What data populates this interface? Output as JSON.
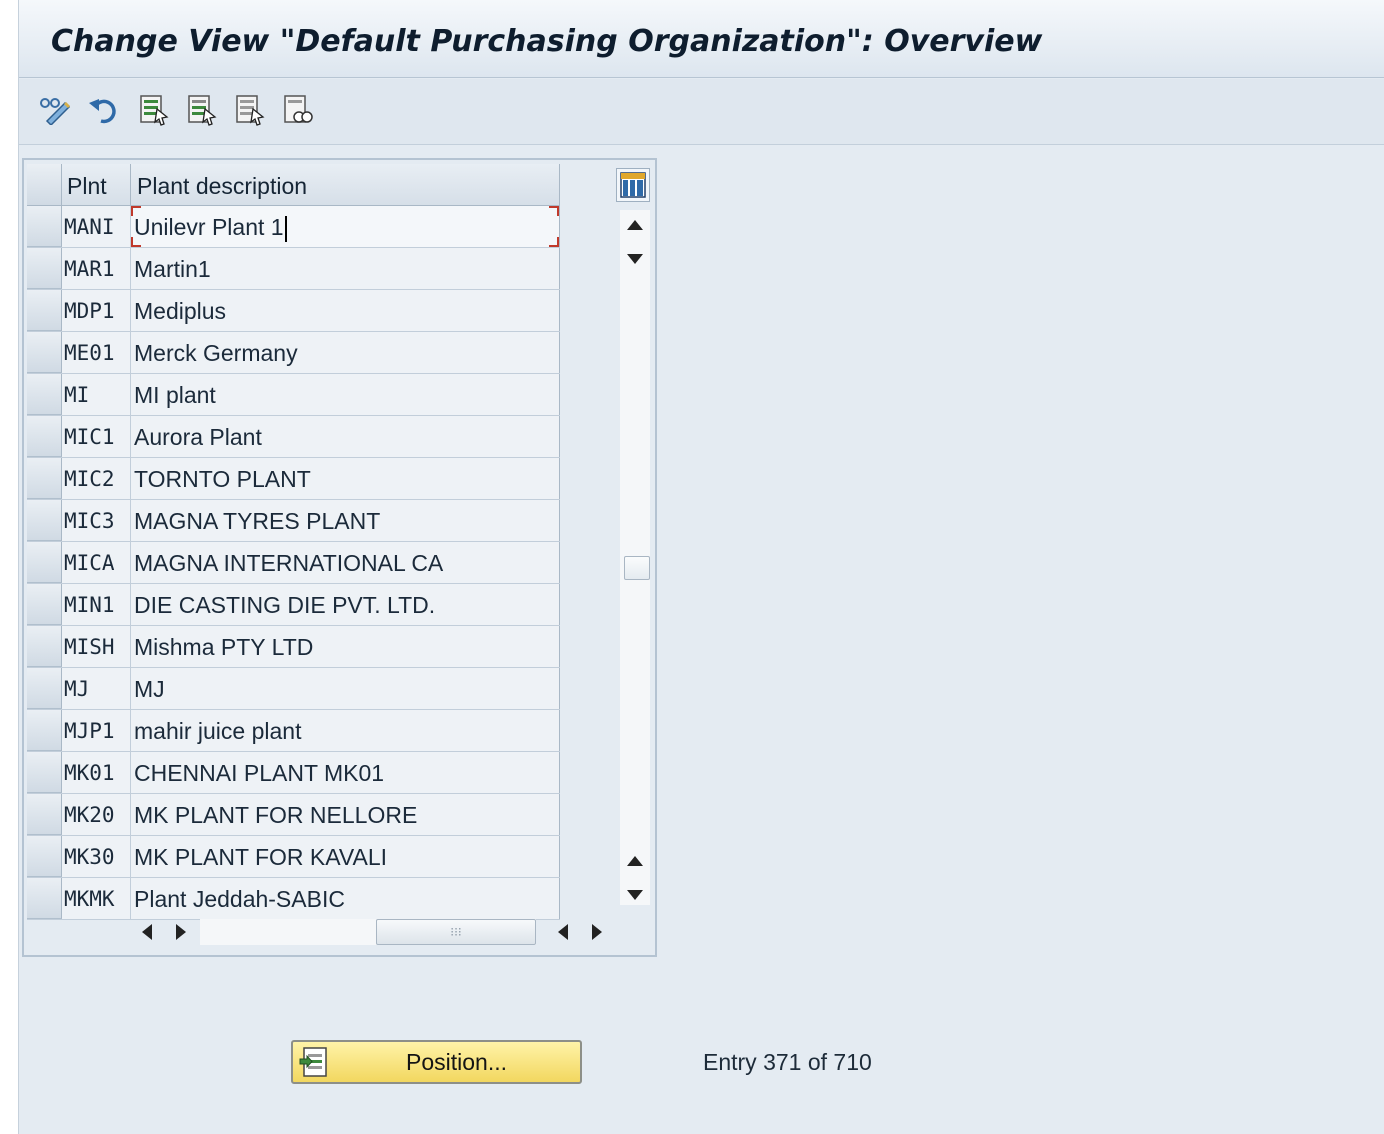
{
  "window": {
    "title": "Change View \"Default Purchasing Organization\": Overview"
  },
  "toolbar": {
    "buttons": [
      {
        "icon": "display-change-icon"
      },
      {
        "icon": "undo-icon"
      },
      {
        "icon": "select-all-icon"
      },
      {
        "icon": "select-block-icon"
      },
      {
        "icon": "deselect-all-icon"
      },
      {
        "icon": "print-view-icon"
      }
    ]
  },
  "table": {
    "columns": {
      "plnt": "Plnt",
      "description": "Plant description"
    },
    "rows": [
      {
        "plnt": "MANI",
        "description": "Unilevr Plant 1"
      },
      {
        "plnt": "MAR1",
        "description": "Martin1"
      },
      {
        "plnt": "MDP1",
        "description": "Mediplus"
      },
      {
        "plnt": "ME01",
        "description": "Merck Germany"
      },
      {
        "plnt": "MI",
        "description": "MI plant"
      },
      {
        "plnt": "MIC1",
        "description": "Aurora Plant"
      },
      {
        "plnt": "MIC2",
        "description": "TORNTO PLANT"
      },
      {
        "plnt": "MIC3",
        "description": "MAGNA  TYRES PLANT"
      },
      {
        "plnt": "MICA",
        "description": "MAGNA INTERNATIONAL CA"
      },
      {
        "plnt": "MIN1",
        "description": "DIE CASTING DIE PVT. LTD."
      },
      {
        "plnt": "MISH",
        "description": "Mishma PTY LTD"
      },
      {
        "plnt": "MJ",
        "description": "MJ"
      },
      {
        "plnt": "MJP1",
        "description": "mahir juice plant"
      },
      {
        "plnt": "MK01",
        "description": "CHENNAI PLANT MK01"
      },
      {
        "plnt": "MK20",
        "description": "MK PLANT FOR NELLORE"
      },
      {
        "plnt": "MK30",
        "description": "MK PLANT FOR KAVALI"
      },
      {
        "plnt": "MKMK",
        "description": "Plant Jeddah-SABIC"
      }
    ],
    "scroll_position": 0.5
  },
  "footer": {
    "position_button": "Position...",
    "entry_info": "Entry 371 of 710"
  },
  "colors": {
    "window_bg": "#e4ebf2",
    "position_button": "#f7e27e",
    "focus_marker": "#c0392b"
  }
}
